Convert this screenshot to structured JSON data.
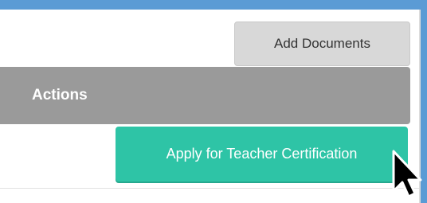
{
  "toolbar": {
    "add_documents_label": "Add Documents"
  },
  "actions_section": {
    "header_label": "Actions",
    "apply_button_label": "Apply for Teacher Certification"
  },
  "colors": {
    "frame_blue": "#5b9bd5",
    "header_gray": "#9a9a9a",
    "add_button_gray": "#d8d8d8",
    "apply_button_teal": "#2ec4a6"
  },
  "icons": {
    "cursor": "mouse-pointer-icon"
  }
}
